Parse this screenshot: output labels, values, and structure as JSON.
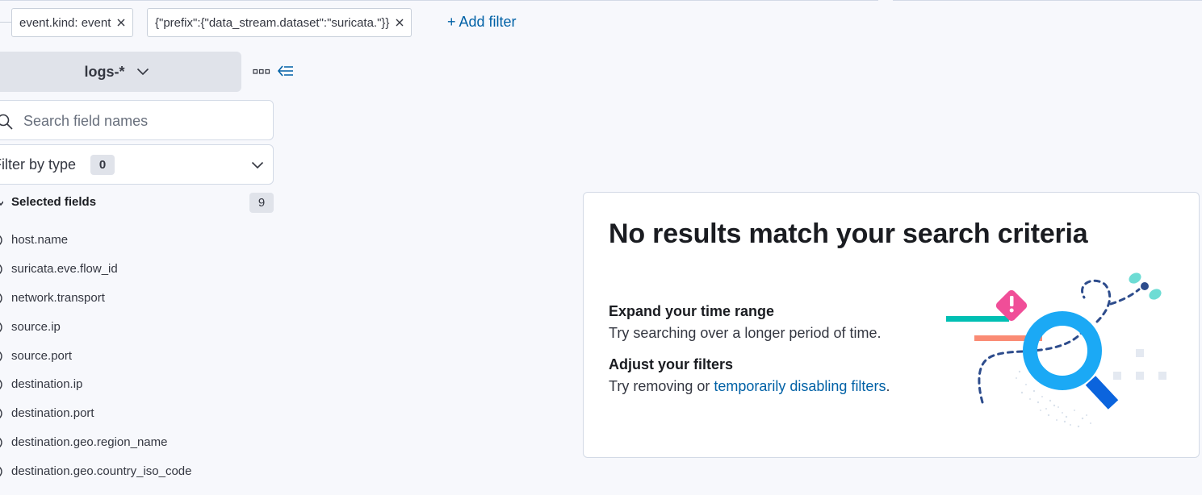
{
  "filters": [
    {
      "label": "event.kind: event",
      "remove_icon": "close-icon"
    },
    {
      "label": "{\"prefix\":{\"data_stream.dataset\":\"suricata.\"}}",
      "remove_icon": "close-icon"
    }
  ],
  "add_filter_label": "+ Add filter",
  "index_pattern": {
    "label": "logs-*",
    "icon": "chevron-down-icon"
  },
  "search": {
    "placeholder": "Search field names",
    "value": ""
  },
  "filter_by_type": {
    "label": "Filter by type",
    "count": "0"
  },
  "selected_fields": {
    "title": "Selected fields",
    "count": "9",
    "items": [
      "host.name",
      "suricata.eve.flow_id",
      "network.transport",
      "source.ip",
      "source.port",
      "destination.ip",
      "destination.port",
      "destination.geo.region_name",
      "destination.geo.country_iso_code"
    ]
  },
  "empty_state": {
    "title": "No results match your search criteria",
    "tip1_heading": "Expand your time range",
    "tip1_text": "Try searching over a longer period of time.",
    "tip2_heading": "Adjust your filters",
    "tip2_text_prefix": "Try removing or ",
    "tip2_link": "temporarily disabling filters",
    "tip2_text_suffix": "."
  },
  "colors": {
    "link": "#0061a6",
    "accent_blue": "#1ba9f5",
    "accent_pink": "#f04e98",
    "accent_teal": "#00bfb3",
    "accent_salmon": "#fa744e",
    "dark_blue": "#0b64dd"
  }
}
